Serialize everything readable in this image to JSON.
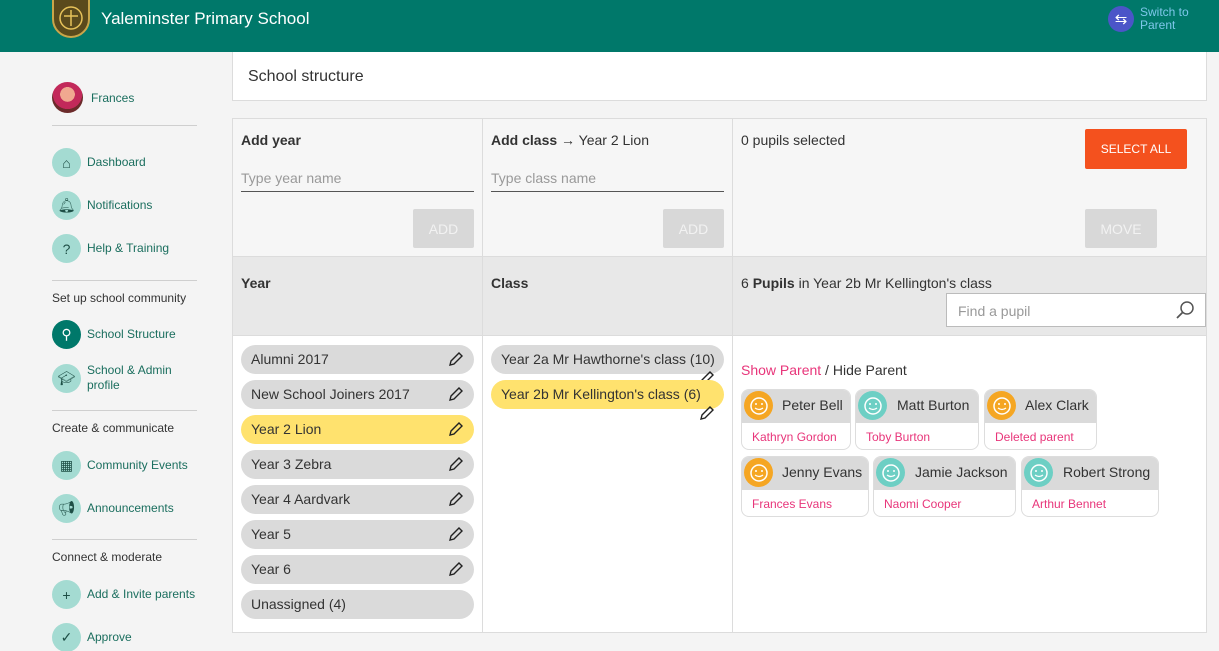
{
  "header": {
    "school_name": "Yaleminster Primary School",
    "switch_label": "Switch to Parent"
  },
  "user": {
    "name": "Frances"
  },
  "sidebar": {
    "items": [
      {
        "label": "Dashboard",
        "icon": "home-icon"
      },
      {
        "label": "Notifications",
        "icon": "bell-icon"
      },
      {
        "label": "Help & Training",
        "icon": "question-icon"
      },
      {
        "label": "School Structure",
        "icon": "structure-icon"
      },
      {
        "label": "School & Admin profile",
        "icon": "graduation-cap-icon"
      },
      {
        "label": "Community Events",
        "icon": "calendar-icon"
      },
      {
        "label": "Announcements",
        "icon": "megaphone-icon"
      },
      {
        "label": "Add & Invite parents",
        "icon": "add-user-icon"
      },
      {
        "label": "Approve",
        "icon": "approve-icon"
      }
    ],
    "sections": [
      "Set up school community",
      "Create & communicate",
      "Connect & moderate"
    ]
  },
  "page": {
    "title": "School structure"
  },
  "add_year": {
    "label": "Add year",
    "placeholder": "Type year name",
    "button": "ADD"
  },
  "add_class": {
    "label": "Add class",
    "arrow": "→",
    "target": "Year 2 Lion",
    "placeholder": "Type class name",
    "button": "ADD"
  },
  "selection": {
    "count_text": "0 pupils selected",
    "select_all": "SELECT ALL",
    "move": "MOVE"
  },
  "columns": {
    "year": "Year",
    "class": "Class",
    "pupils_count": "6",
    "pupils_word": "Pupils",
    "pupils_rest": "in Year 2b Mr Kellington's class",
    "search_placeholder": "Find a pupil"
  },
  "years": [
    "Alumni 2017",
    "New School Joiners 2017",
    "Year 2 Lion",
    "Year 3 Zebra",
    "Year 4 Aardvark",
    "Year 5",
    "Year 6",
    "Unassigned (4)"
  ],
  "classes": [
    "Year 2a Mr Hawthorne's class (10)",
    "Year 2b Mr Kellington's class (6)"
  ],
  "parent_toggle": {
    "show": "Show Parent",
    "sep": " / ",
    "hide": "Hide Parent"
  },
  "pupils": [
    {
      "name": "Peter Bell",
      "parent": "Kathryn Gordon",
      "face": "orange"
    },
    {
      "name": "Matt Burton",
      "parent": "Toby Burton",
      "face": "teal"
    },
    {
      "name": "Alex Clark",
      "parent": "Deleted parent",
      "face": "orange"
    },
    {
      "name": "Jenny Evans",
      "parent": "Frances Evans",
      "face": "orange"
    },
    {
      "name": "Jamie Jackson",
      "parent": "Naomi Cooper",
      "face": "teal"
    },
    {
      "name": "Robert Strong",
      "parent": "Arthur Bennet",
      "face": "teal"
    }
  ],
  "colors": {
    "brand": "#00786a",
    "accent_orange": "#f4511e",
    "selected": "#ffe26e",
    "parent_pink": "#e8357a"
  }
}
